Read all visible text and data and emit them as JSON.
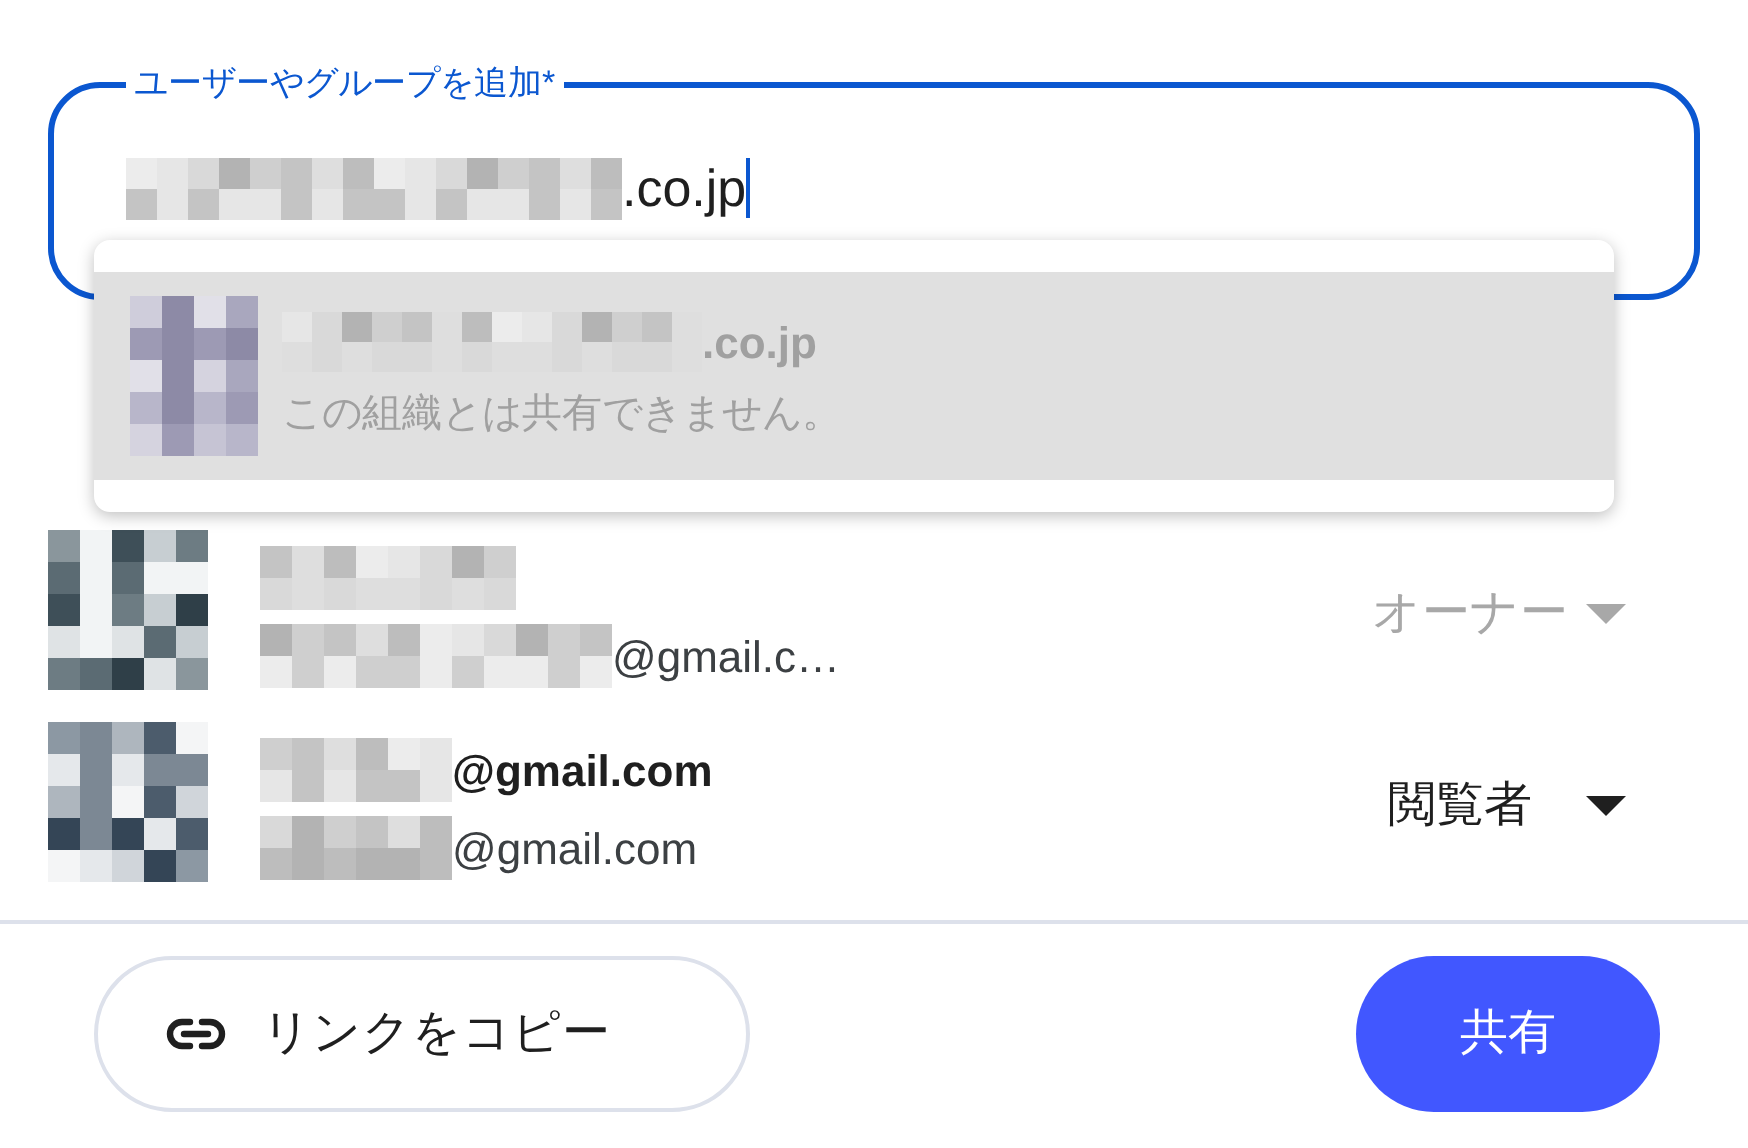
{
  "field": {
    "label": "ユーザーやグループを追加*",
    "value": ".co.jp",
    "focused": true
  },
  "suggestion": {
    "email": ".co.jp",
    "note": "この組織とは共有できません。",
    "disabled": true
  },
  "people": [
    {
      "email": "@gmail.c…",
      "role": "オーナー",
      "role_disabled": true
    },
    {
      "name": "@gmail.com",
      "email": "@gmail.com",
      "role": "閲覧者",
      "role_disabled": false
    }
  ],
  "footer": {
    "copy_link": "リンクをコピー",
    "share": "共有"
  }
}
